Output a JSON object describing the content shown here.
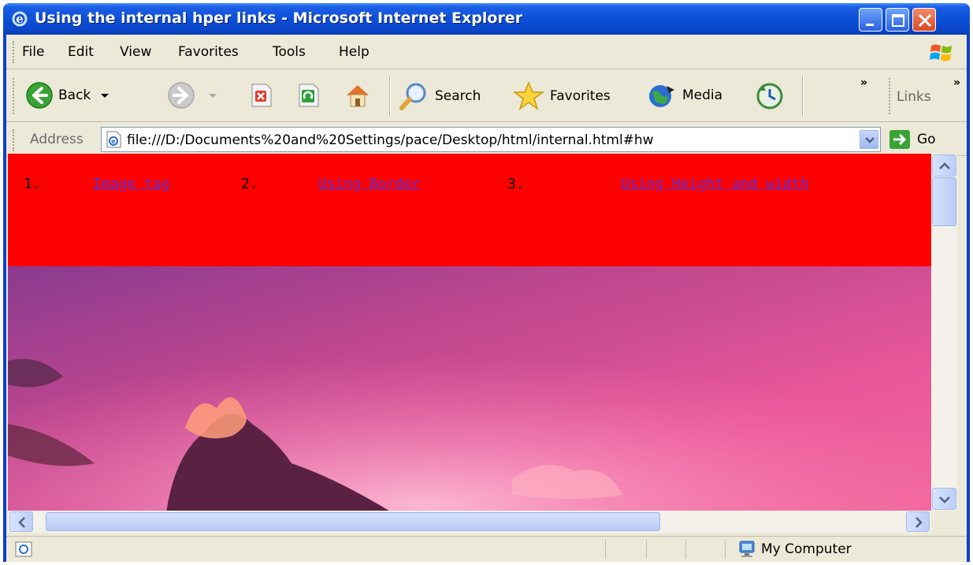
{
  "window": {
    "title": "Using the internal hper links - Microsoft Internet Explorer"
  },
  "menu": {
    "items": [
      "File",
      "Edit",
      "View",
      "Favorites",
      "Tools",
      "Help"
    ]
  },
  "toolbar": {
    "back_label": "Back",
    "search_label": "Search",
    "favorites_label": "Favorites",
    "media_label": "Media",
    "chevron": "»",
    "links_label": "Links"
  },
  "address": {
    "label": "Address",
    "url": "file:///D:/Documents%20and%20Settings/pace/Desktop/html/internal.html#hw",
    "go_label": "Go"
  },
  "page": {
    "band_color": "#ff0000",
    "links": [
      {
        "number": "1.",
        "text": "Image tag "
      },
      {
        "number": "2.",
        "text": "Using Border"
      },
      {
        "number": "3.",
        "text": "Using Height and width"
      }
    ]
  },
  "status": {
    "zone": "My Computer"
  }
}
